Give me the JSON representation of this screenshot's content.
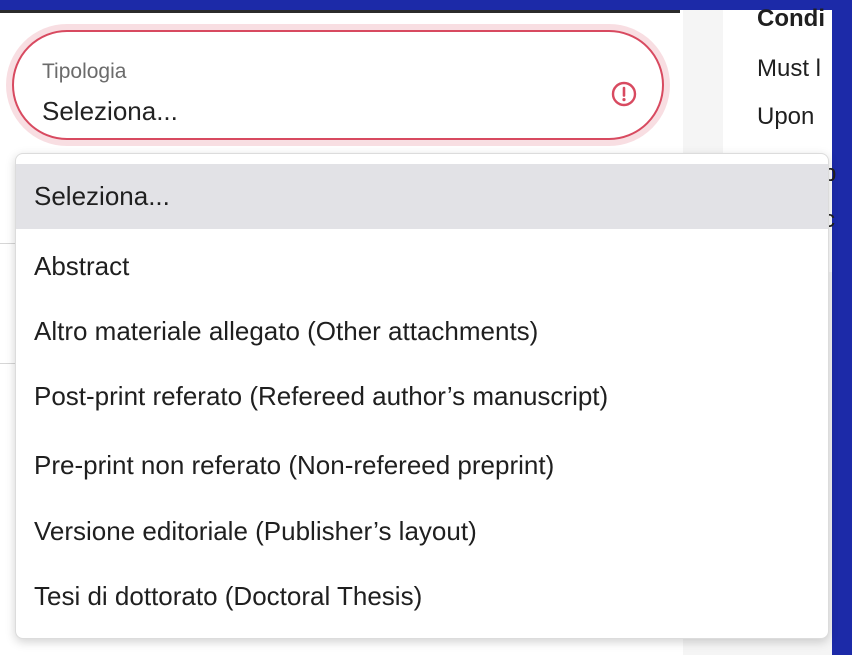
{
  "select": {
    "label": "Tipologia",
    "value": "Seleziona...",
    "state": "error",
    "icon": "alert-circle-icon",
    "accent_color": "#d84a60"
  },
  "dropdown": {
    "options": [
      {
        "label": "Seleziona...",
        "selected": true
      },
      {
        "label": "Abstract"
      },
      {
        "label": "Altro materiale allegato (Other attachments)"
      },
      {
        "label": "Post-print referato (Refereed author’s manuscript)"
      },
      {
        "label": "Pre-print non referato (Non-refereed preprint)"
      },
      {
        "label": "Versione editoriale (Publisher’s layout)"
      },
      {
        "label": "Tesi di dottorato (Doctoral Thesis)"
      }
    ]
  },
  "right_panel": {
    "lines": [
      "Condi",
      "Must l",
      "Upon",
      "-p",
      "-c"
    ]
  },
  "colors": {
    "frame": "#1c2aa8",
    "selected_bg": "#e2e2e6"
  }
}
